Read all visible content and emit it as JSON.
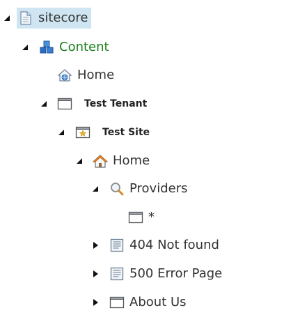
{
  "tree": {
    "sitecore": {
      "label": "sitecore",
      "icon": "document-icon",
      "expander": "expanded"
    },
    "content": {
      "label": "Content",
      "icon": "content-cubes-icon",
      "expander": "expanded",
      "color": "#1a7f1a"
    },
    "home_root": {
      "label": "Home",
      "icon": "home-globe-icon"
    },
    "test_tenant": {
      "label": "Test Tenant",
      "icon": "window-icon",
      "expander": "expanded"
    },
    "test_site": {
      "label": "Test Site",
      "icon": "site-star-icon",
      "expander": "expanded"
    },
    "home_site": {
      "label": "Home",
      "icon": "home-icon",
      "expander": "expanded"
    },
    "providers": {
      "label": "Providers",
      "icon": "magnifier-icon",
      "expander": "expanded"
    },
    "wildcard": {
      "label": "*",
      "icon": "window-icon"
    },
    "not_found": {
      "label": "404 Not found",
      "icon": "page-lines-icon",
      "expander": "collapsed"
    },
    "error_page": {
      "label": "500 Error Page",
      "icon": "page-lines-icon",
      "expander": "collapsed"
    },
    "about_us": {
      "label": "About Us",
      "icon": "window-icon",
      "expander": "collapsed"
    }
  },
  "colors": {
    "selected_background": "#cfe6f2",
    "content_text": "#1a7f1a",
    "expander": "#111111"
  }
}
